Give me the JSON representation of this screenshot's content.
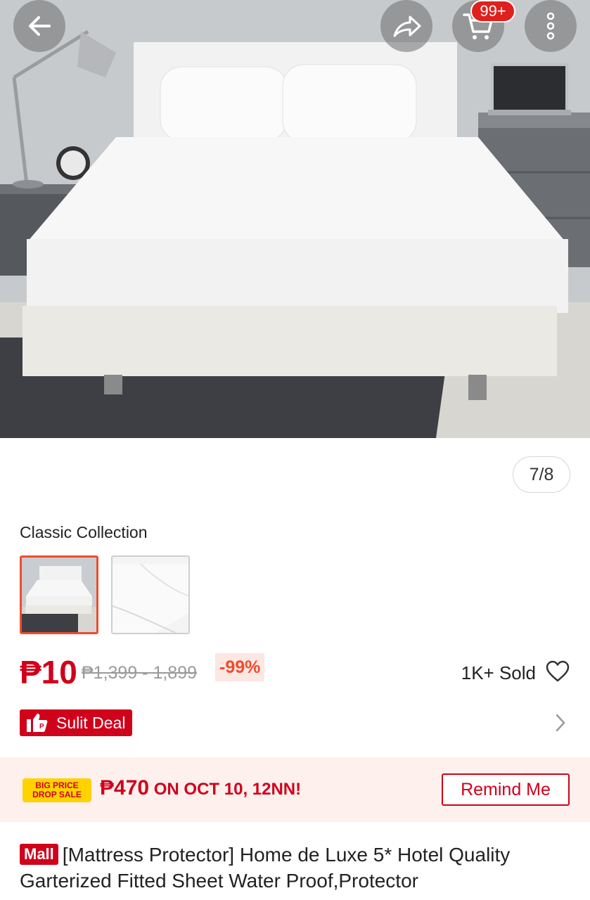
{
  "header": {
    "cart_badge": "99+",
    "icons": [
      "back-arrow-icon",
      "share-icon",
      "cart-icon",
      "more-vertical-icon"
    ]
  },
  "gallery": {
    "counter": "7/8"
  },
  "variation": {
    "label": "Classic Collection"
  },
  "price": {
    "current": "₱10",
    "original_range": "₱1,399 - 1,899",
    "discount": "-99%",
    "sold": "1K+ Sold"
  },
  "deal": {
    "label": "Sulit Deal"
  },
  "promo": {
    "badge_line1": "BIG PRICE",
    "badge_line2": "DROP SALE",
    "amount": "₱470",
    "text": " ON OCT 10, 12NN!",
    "remind_label": "Remind Me"
  },
  "product": {
    "mall_tag": "Mall",
    "title": "[Mattress Protector] Home de Luxe 5* Hotel Quality Garterized Fitted Sheet Water Proof,Protector"
  },
  "colors": {
    "brand_red": "#d0011b",
    "accent_orange": "#ee4d2d"
  }
}
